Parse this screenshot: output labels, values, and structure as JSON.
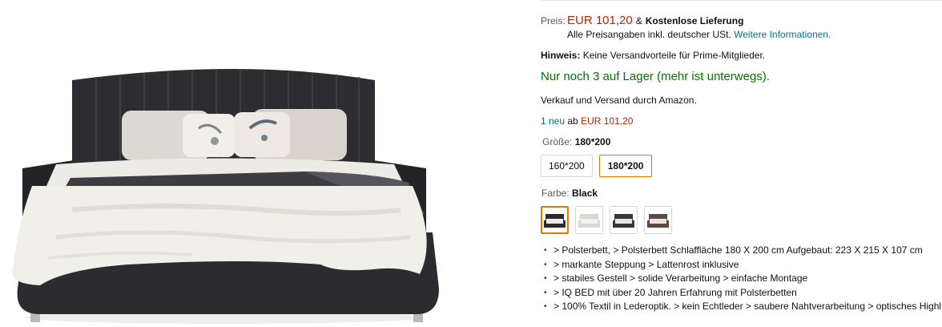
{
  "price": {
    "label": "Preis:",
    "value": "EUR 101,20",
    "amp": "&",
    "free_shipping": "Kostenlose Lieferung",
    "vat_note": "Alle Preisangaben inkl. deutscher USt.",
    "more_info_link": "Weitere Informationen."
  },
  "hint": {
    "label": "Hinweis:",
    "text": "Keine Versandvorteile für Prime-Mitglieder."
  },
  "stock": "Nur noch 3 auf Lager (mehr ist unterwegs).",
  "seller": "Verkauf und Versand durch Amazon.",
  "offers": {
    "new_link": "1 neu",
    "from": "ab",
    "price": "EUR 101,20"
  },
  "size": {
    "label": "Größe:",
    "selected": "180*200",
    "options": [
      "160*200",
      "180*200"
    ]
  },
  "color": {
    "label": "Farbe:",
    "selected": "Black",
    "swatches": [
      {
        "icon": "bed-black-thumbnail-icon",
        "color": "#2b2b30"
      },
      {
        "icon": "bed-white-thumbnail-icon",
        "color": "#d9d7d2"
      },
      {
        "icon": "bed-dark-thumbnail-icon",
        "color": "#34383d"
      },
      {
        "icon": "bed-brown-thumbnail-icon",
        "color": "#5a4a42"
      }
    ]
  },
  "features": [
    "> Polsterbett, > Polsterbett Schlaffläche 180 X 200 cm Aufgebaut: 223 X 215 X 107 cm",
    "> markante Steppung > Lattenrost inklusive",
    "> stabiles Gestell > solide Verarbeitung > einfache Montage",
    "> IQ BED mit über 20 Jahren Erfahrung mit Polsterbetten",
    "> 100% Textil in Lederoptik. > kein Echtleder > saubere Nahtverarbeitung > optisches Highl"
  ],
  "colors": {
    "price_red": "#b12704",
    "link_teal": "#007185",
    "stock_green": "#007600",
    "selected_orange": "#e77600",
    "bed_frame": "#2b2b30"
  }
}
